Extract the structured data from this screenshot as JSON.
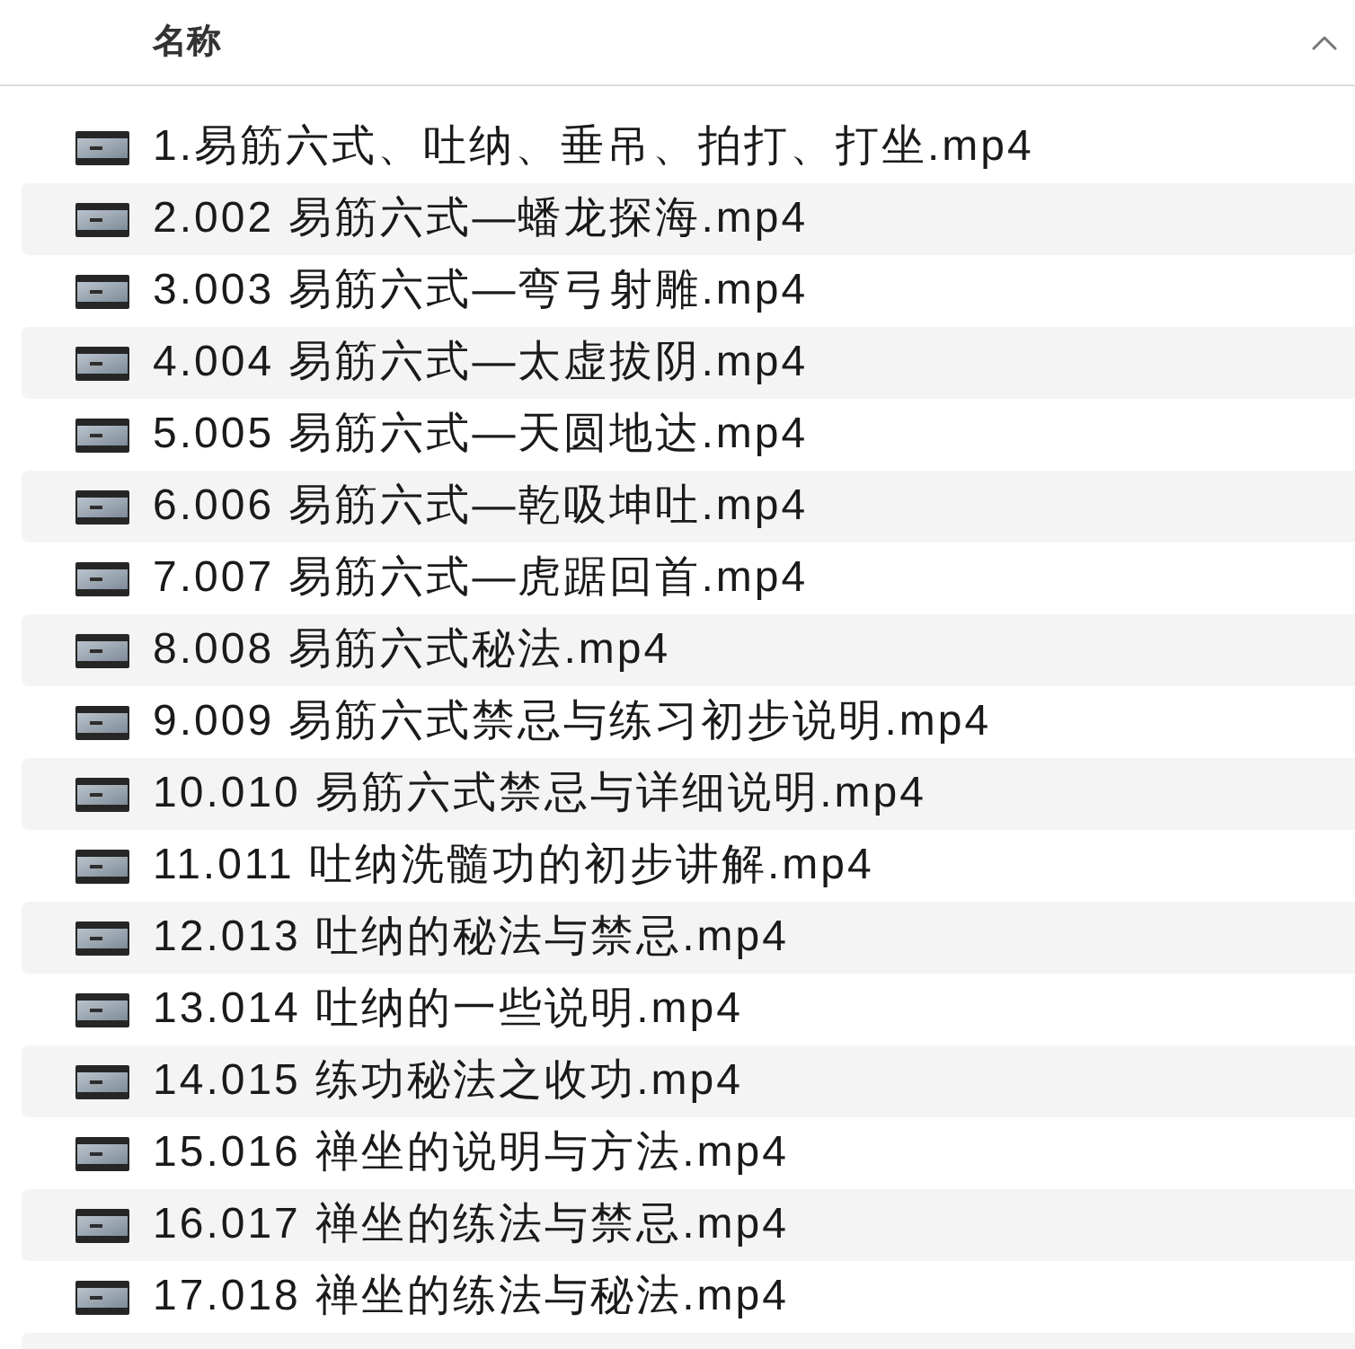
{
  "header": {
    "columns": [
      {
        "label": "名称",
        "sort_ascending": true
      }
    ]
  },
  "files": [
    "1.易筋六式、吐纳、垂吊、拍打、打坐.mp4",
    "2.002 易筋六式—蟠龙探海.mp4",
    "3.003 易筋六式—弯弓射雕.mp4",
    "4.004 易筋六式—太虚拔阴.mp4",
    "5.005 易筋六式—天圆地达.mp4",
    "6.006 易筋六式—乾吸坤吐.mp4",
    "7.007 易筋六式—虎踞回首.mp4",
    "8.008 易筋六式秘法.mp4",
    "9.009 易筋六式禁忌与练习初步说明.mp4",
    "10.010 易筋六式禁忌与详细说明.mp4",
    "11.011 吐纳洗髓功的初步讲解.mp4",
    "12.013 吐纳的秘法与禁忌.mp4",
    "13.014 吐纳的一些说明.mp4",
    "14.015 练功秘法之收功.mp4",
    "15.016 禅坐的说明与方法.mp4",
    "16.017 禅坐的练法与禁忌.mp4",
    "17.018 禅坐的练法与秘法.mp4"
  ]
}
